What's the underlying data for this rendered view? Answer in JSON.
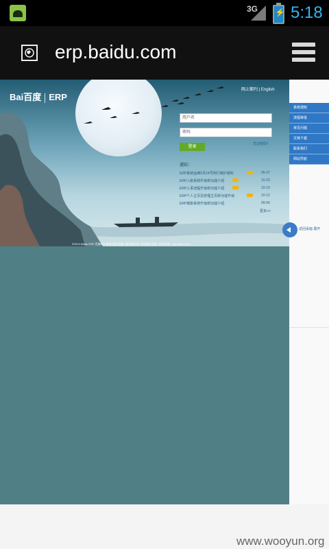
{
  "status_bar": {
    "network": "3G",
    "time": "5:18"
  },
  "browser": {
    "url": "erp.baidu.com"
  },
  "erp": {
    "logo_text": "Bai百度",
    "logo_suffix": "ERP",
    "top_links": "网上期刊 | English",
    "username_placeholder": "用户名",
    "password_placeholder": "密码",
    "login_label": "登录",
    "forgot_label": "忘记密码？",
    "notice_title": "通知：",
    "notices": [
      {
        "text": "ERP系统运维5月24号例行维护通知",
        "date": "05-27"
      },
      {
        "text": "ERP入职系统升级新功能介绍",
        "date": "10-23"
      },
      {
        "text": "ERP入事流程升级新功能介绍",
        "date": "10-19"
      },
      {
        "text": "ERP个人主页及管理主页新功能升级",
        "date": "10-12"
      },
      {
        "text": "ERP离职系统升级新功能介绍",
        "date": "09-06"
      }
    ],
    "more_label": "更多>>",
    "copyright": "©2013 Baidu ERP 百度ERP系统 意见反馈 | 使用前必读 本系统由百度 | 技术支持：erp-baidu.com"
  },
  "sidebar": {
    "items": [
      "系统通知",
      "流程审批",
      "常见问题",
      "文档下载",
      "联系我们",
      "网站导航"
    ],
    "back_label": "返回桌面 展开"
  },
  "watermark": "www.wooyun.org"
}
